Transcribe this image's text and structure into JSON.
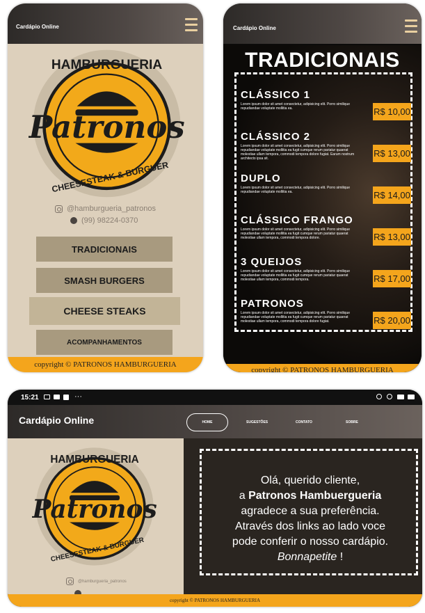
{
  "brand": {
    "accent": "#f4a51c",
    "beige": "#ddd0bc",
    "logo_top": "HAMBURGUERIA",
    "logo_main": "Patronos",
    "logo_bottom": "CHEESESTEAK & BURGUER"
  },
  "header": {
    "title": "Cardápio Online",
    "menu_icon": "hamburger-menu-icon"
  },
  "contact": {
    "instagram": "@hamburgueria_patronos",
    "phone": "(99) 98224-0370"
  },
  "menu": {
    "items": [
      {
        "label": "TRADICIONAIS"
      },
      {
        "label": "SMASH BURGERS"
      },
      {
        "label": "CHEESE STEAKS"
      },
      {
        "label": "ACOMPANHAMENTOS"
      }
    ]
  },
  "copyright": "copyright © PATRONOS HAMBURGUERIA",
  "tradicionais": {
    "title": "TRADICIONAIS",
    "items": [
      {
        "name": "CLÁSSICO 1",
        "desc": "Lorem ipsum dolor sit amet consectetur, adipisicing elit. Porro similique repudiandae voluptate mollitia ea.",
        "price": "R$ 10,00"
      },
      {
        "name": "CLÁSSICO 2",
        "desc": "Lorem ipsum dolor sit amet consectetur, adipisicing elit. Porro similique repudiandae voluptate mollitia ea fugit cumque rerum pariatur quaerat molestiae ullam tempora, commodi tempora dolore fugiat. Earum nostrum architecto ipsa sit.",
        "price": "R$ 13,00"
      },
      {
        "name": "DUPLO",
        "desc": "Lorem ipsum dolor sit amet consectetur, adipisicing elit. Porro similique repudiandae voluptate mollitia ea.",
        "price": "R$ 14,00"
      },
      {
        "name": "CLÁSSICO FRANGO",
        "desc": "Lorem ipsum dolor sit amet consectetur, adipisicing elit. Porro similique repudiandae voluptate mollitia ea fugit cumque rerum pariatur quaerat molestiae ullam tempora, commodi tempora dolore.",
        "price": "R$ 13,00"
      },
      {
        "name": "3 QUEIJOS",
        "desc": "Lorem ipsum dolor sit amet consectetur, adipisicing elit. Porro similique repudiandae voluptate mollitia ea fugit cumque rerum pariatur quaerat molestiae ullam tempora, commodi tempora.",
        "price": "R$ 17,00"
      },
      {
        "name": "PATRONOS",
        "desc": "Lorem ipsum dolor sit amet consectetur, adipisicing elit. Porro similique repudiandae voluptate mollitia ea fugit cumque rerum pariatur quaerat molestiae ullam tempora, commodi tempora dolore fugiat.",
        "price": "R$ 20,00"
      }
    ]
  },
  "status_bar": {
    "time": "15:21",
    "dots": "···"
  },
  "nav": {
    "items": [
      {
        "label": "HOME"
      },
      {
        "label": "SUGESTÕES"
      },
      {
        "label": "CONTATO"
      },
      {
        "label": "SOBRE"
      }
    ]
  },
  "welcome": {
    "line1": "Olá, querido cliente,",
    "line2_pre": "a ",
    "line2_brand": "Patronos Hambuergueria",
    "line3": "agradece a sua preferência.",
    "line4": "Através dos links ao lado voce",
    "line5": "pode conferir o nosso cardápio.",
    "line6_italic": "Bonnapetite",
    "line6_end": " !"
  }
}
